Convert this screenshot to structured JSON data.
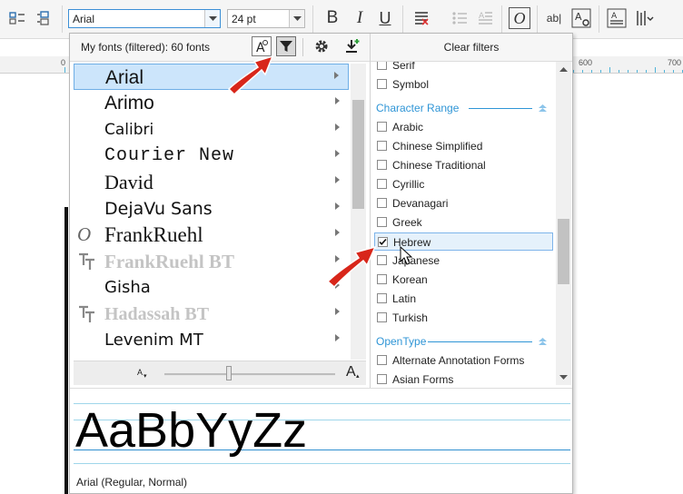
{
  "toolbar": {
    "font_value": "Arial",
    "size_value": "24 pt",
    "bold_label": "B",
    "italic_label": "I",
    "underline_label": "U",
    "text_tool_label": "ab|",
    "char_props_label": "A"
  },
  "ruler": {
    "labels": [
      "0",
      "600",
      "700"
    ]
  },
  "font_panel": {
    "count_label": "My fonts (filtered): 60 fonts",
    "fonts": [
      {
        "name": "Arial",
        "icon": "opentype-icon",
        "selected": true
      },
      {
        "name": "Arimo",
        "icon": "opentype-icon",
        "selected": false
      },
      {
        "name": "Calibri",
        "icon": "opentype-icon",
        "selected": false
      },
      {
        "name": "Courier New",
        "icon": "opentype-icon",
        "selected": false
      },
      {
        "name": "David",
        "icon": "opentype-icon",
        "selected": false
      },
      {
        "name": "DejaVu Sans",
        "icon": "opentype-icon",
        "selected": false
      },
      {
        "name": "FrankRuehl",
        "icon": "opentype-o-icon",
        "selected": false
      },
      {
        "name": "FrankRuehl BT",
        "icon": "truetype-icon",
        "selected": false
      },
      {
        "name": "Gisha",
        "icon": "opentype-icon",
        "selected": false
      },
      {
        "name": "Hadassah BT",
        "icon": "truetype-icon",
        "selected": false
      },
      {
        "name": "Levenim MT",
        "icon": "opentype-icon",
        "selected": false
      }
    ],
    "zoom_small": "A",
    "zoom_large": "A",
    "zoom_level": 0.38
  },
  "filters": {
    "clear_label": "Clear filters",
    "top_items": [
      "Serif",
      "Symbol"
    ],
    "sections": [
      {
        "title": "Character Range",
        "items": [
          {
            "label": "Arabic",
            "checked": false
          },
          {
            "label": "Chinese Simplified",
            "checked": false
          },
          {
            "label": "Chinese Traditional",
            "checked": false
          },
          {
            "label": "Cyrillic",
            "checked": false
          },
          {
            "label": "Devanagari",
            "checked": false
          },
          {
            "label": "Greek",
            "checked": false
          },
          {
            "label": "Hebrew",
            "checked": true
          },
          {
            "label": "Japanese",
            "checked": false
          },
          {
            "label": "Korean",
            "checked": false
          },
          {
            "label": "Latin",
            "checked": false
          },
          {
            "label": "Turkish",
            "checked": false
          }
        ]
      },
      {
        "title": "OpenType",
        "items": [
          {
            "label": "Alternate Annotation Forms",
            "checked": false
          },
          {
            "label": "Asian Forms",
            "checked": false
          }
        ]
      }
    ]
  },
  "preview": {
    "sample": "AaBbYyZz",
    "description": "Arial (Regular, Normal)"
  },
  "colors": {
    "accent": "#2f95d6",
    "selection": "#cce5fb",
    "annotation_arrow": "#d8261a"
  }
}
